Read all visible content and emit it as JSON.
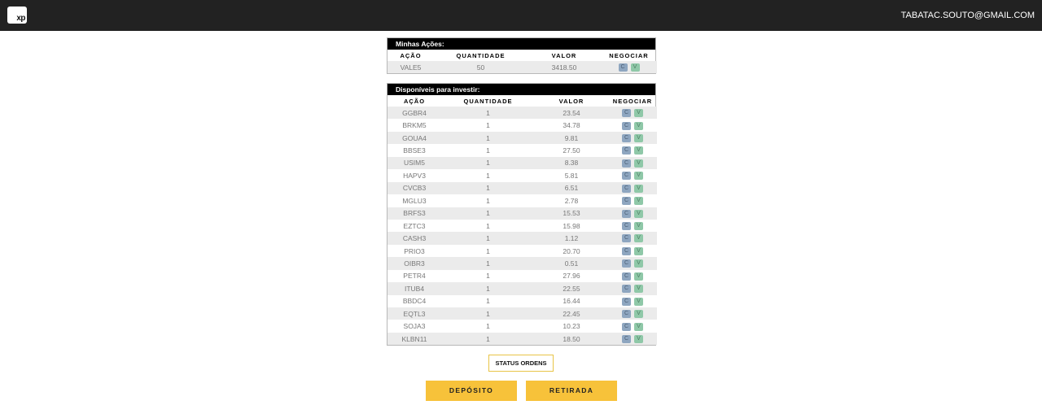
{
  "header": {
    "logo_text": "xp",
    "user_email": "TABATAC.SOUTO@GMAIL.COM"
  },
  "my_stocks": {
    "title": "Minhas Ações:",
    "columns": [
      "AÇÃO",
      "QUANTIDADE",
      "VALOR",
      "NEGOCIAR"
    ],
    "rows": [
      {
        "acao": "VALE5",
        "quantidade": "50",
        "valor": "3418.50"
      }
    ]
  },
  "available": {
    "title": "Disponíveis para investir:",
    "columns": [
      "AÇÃO",
      "QUANTIDADE",
      "VALOR",
      "NEGOCIAR"
    ],
    "rows": [
      {
        "acao": "GGBR4",
        "quantidade": "1",
        "valor": "23.54"
      },
      {
        "acao": "BRKM5",
        "quantidade": "1",
        "valor": "34.78"
      },
      {
        "acao": "GOUA4",
        "quantidade": "1",
        "valor": "9.81"
      },
      {
        "acao": "BBSE3",
        "quantidade": "1",
        "valor": "27.50"
      },
      {
        "acao": "USIM5",
        "quantidade": "1",
        "valor": "8.38"
      },
      {
        "acao": "HAPV3",
        "quantidade": "1",
        "valor": "5.81"
      },
      {
        "acao": "CVCB3",
        "quantidade": "1",
        "valor": "6.51"
      },
      {
        "acao": "MGLU3",
        "quantidade": "1",
        "valor": "2.78"
      },
      {
        "acao": "BRFS3",
        "quantidade": "1",
        "valor": "15.53"
      },
      {
        "acao": "EZTC3",
        "quantidade": "1",
        "valor": "15.98"
      },
      {
        "acao": "CASH3",
        "quantidade": "1",
        "valor": "1.12"
      },
      {
        "acao": "PRIO3",
        "quantidade": "1",
        "valor": "20.70"
      },
      {
        "acao": "OIBR3",
        "quantidade": "1",
        "valor": "0.51"
      },
      {
        "acao": "PETR4",
        "quantidade": "1",
        "valor": "27.96"
      },
      {
        "acao": "ITUB4",
        "quantidade": "1",
        "valor": "22.55"
      },
      {
        "acao": "BBDC4",
        "quantidade": "1",
        "valor": "16.44"
      },
      {
        "acao": "EQTL3",
        "quantidade": "1",
        "valor": "22.45"
      },
      {
        "acao": "SOJA3",
        "quantidade": "1",
        "valor": "10.23"
      },
      {
        "acao": "KLBN11",
        "quantidade": "1",
        "valor": "18.50"
      }
    ]
  },
  "trade_buttons": {
    "buy_label": "C",
    "sell_label": "V"
  },
  "actions": {
    "status_label": "STATUS ORDENS",
    "deposit_label": "DEPÓSITO",
    "withdraw_label": "RETIRADA"
  },
  "colors": {
    "topbar": "#222222",
    "accent_yellow": "#f7c23a",
    "buy_button": "#8ea6c0",
    "sell_button": "#8fc8a8"
  }
}
